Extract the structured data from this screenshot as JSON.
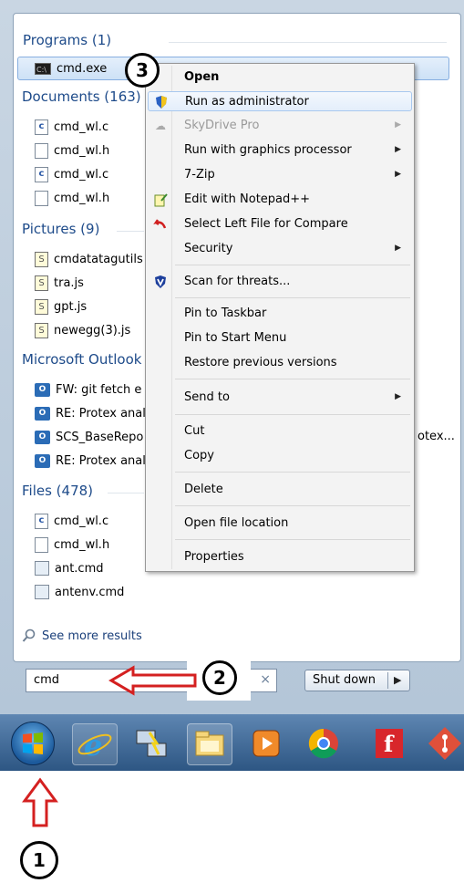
{
  "results": {
    "programs": {
      "header": "Programs (1)",
      "items": [
        {
          "label": "cmd.exe",
          "icon": "cmd-icon"
        }
      ]
    },
    "documents": {
      "header": "Documents (163)",
      "items": [
        {
          "label": "cmd_wl.c",
          "icon": "c-file-icon"
        },
        {
          "label": "cmd_wl.h",
          "icon": "file-icon"
        },
        {
          "label": "cmd_wl.c",
          "icon": "c-file-icon"
        },
        {
          "label": "cmd_wl.h",
          "icon": "file-icon"
        }
      ]
    },
    "pictures": {
      "header": "Pictures (9)",
      "items": [
        {
          "label": "cmdatatagutils",
          "icon": "script-icon"
        },
        {
          "label": "tra.js",
          "icon": "script-icon"
        },
        {
          "label": "gpt.js",
          "icon": "script-icon"
        },
        {
          "label": "newegg(3).js",
          "icon": "script-icon"
        }
      ]
    },
    "outlook": {
      "header": "Microsoft Outlook",
      "items": [
        {
          "label": "FW: git fetch e",
          "icon": "outlook-icon"
        },
        {
          "label": "RE: Protex anal",
          "icon": "outlook-icon"
        },
        {
          "label": "SCS_BaseRepo",
          "icon": "outlook-icon"
        },
        {
          "label": "RE: Protex anal",
          "icon": "outlook-icon"
        }
      ],
      "overflow_text": "otex..."
    },
    "files": {
      "header": "Files (478)",
      "items": [
        {
          "label": "cmd_wl.c",
          "icon": "c-file-icon"
        },
        {
          "label": "cmd_wl.h",
          "icon": "file-icon"
        },
        {
          "label": "ant.cmd",
          "icon": "cmd-script-icon"
        },
        {
          "label": "antenv.cmd",
          "icon": "cmd-script-icon"
        }
      ]
    },
    "see_more": "See more results"
  },
  "search": {
    "value": "cmd",
    "clear_glyph": "×"
  },
  "shutdown": {
    "label": "Shut down",
    "arrow": "▶"
  },
  "context_menu": {
    "items": [
      {
        "label": "Open",
        "bold": true
      },
      {
        "label": "Run as administrator",
        "icon": "shield-icon",
        "highlighted": true
      },
      {
        "label": "SkyDrive Pro",
        "disabled": true,
        "submenu": true,
        "icon": "cloud-icon"
      },
      {
        "label": "Run with graphics processor",
        "submenu": true
      },
      {
        "label": "7-Zip",
        "submenu": true
      },
      {
        "label": "Edit with Notepad++",
        "icon": "notepad-icon"
      },
      {
        "label": "Select Left File for Compare",
        "icon": "compare-icon"
      },
      {
        "label": "Security",
        "submenu": true
      },
      {
        "label": "Scan for threats...",
        "icon": "antivirus-icon"
      },
      {
        "label": "Pin to Taskbar"
      },
      {
        "label": "Pin to Start Menu"
      },
      {
        "label": "Restore previous versions"
      },
      {
        "label": "Send to",
        "submenu": true
      },
      {
        "label": "Cut"
      },
      {
        "label": "Copy"
      },
      {
        "label": "Delete"
      },
      {
        "label": "Open file location"
      },
      {
        "label": "Properties"
      }
    ],
    "submenu_glyph": "▶"
  },
  "taskbar": {
    "items": [
      {
        "icon": "start-orb-icon"
      },
      {
        "icon": "internet-explorer-icon"
      },
      {
        "icon": "network-icon"
      },
      {
        "icon": "file-explorer-icon"
      },
      {
        "icon": "media-player-icon"
      },
      {
        "icon": "chrome-icon"
      },
      {
        "icon": "foxit-reader-icon"
      },
      {
        "icon": "git-icon"
      }
    ]
  },
  "annotations": {
    "step1": "1",
    "step2": "2",
    "step3": "3"
  },
  "colors": {
    "accent": "#1e4b8a",
    "arrow": "#d42020",
    "taskbar": "#2d5683"
  }
}
